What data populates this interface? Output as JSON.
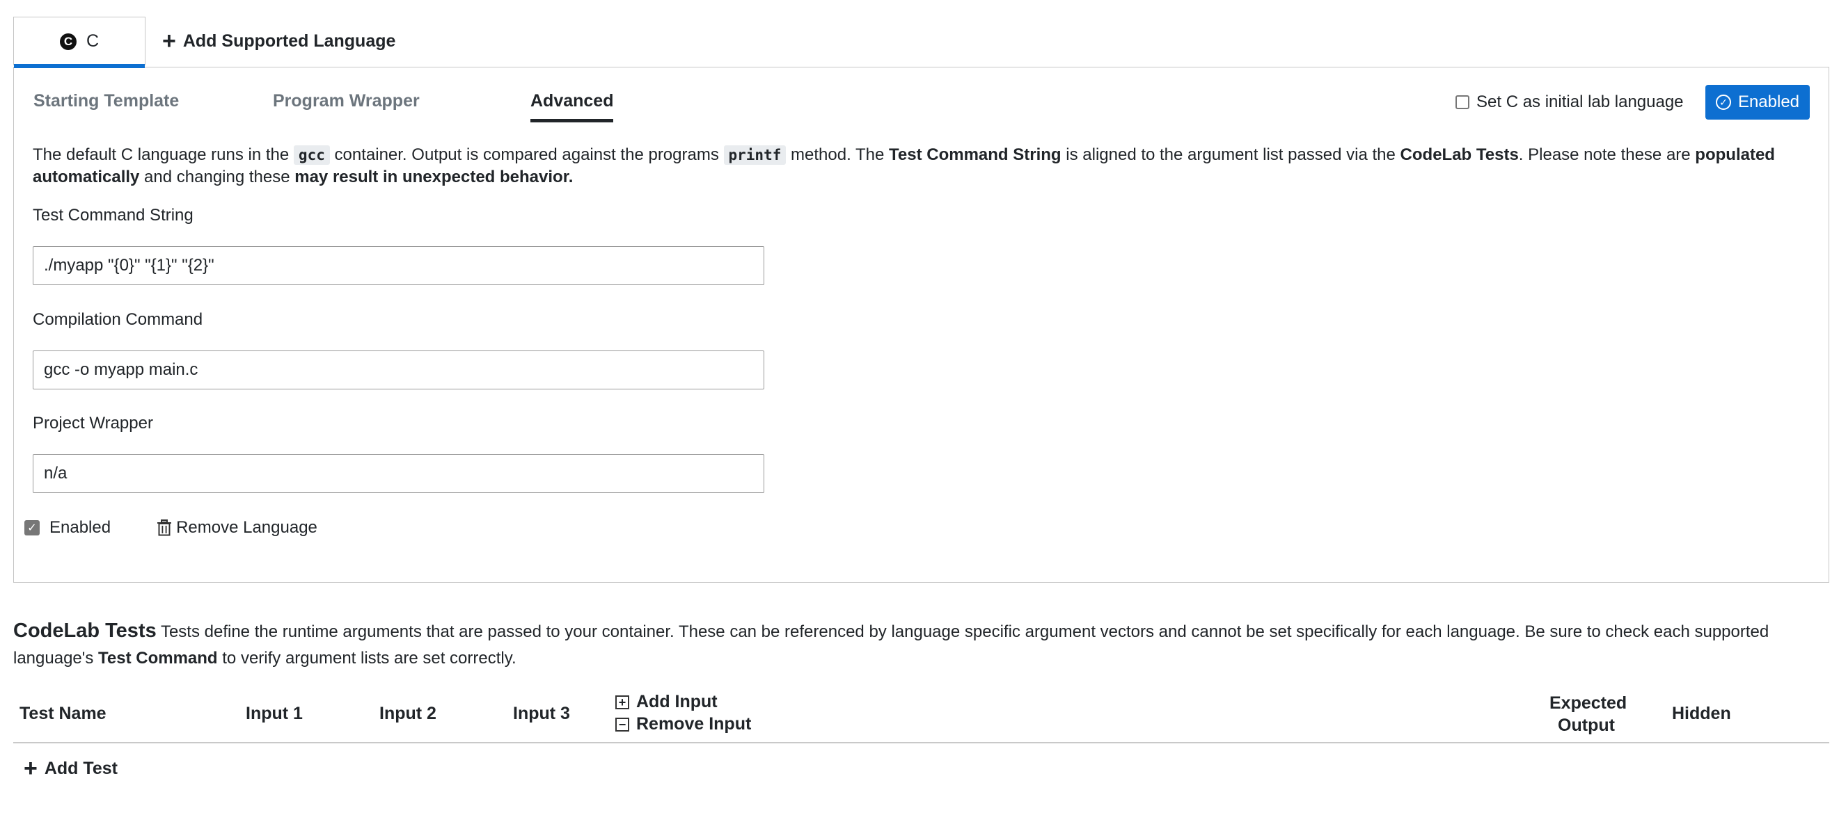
{
  "language_tabs": {
    "active": {
      "icon": "c-language-icon",
      "label": "C"
    },
    "add_label": "Add Supported Language"
  },
  "sub_tabs": [
    {
      "label": "Starting Template",
      "active": false
    },
    {
      "label": "Program Wrapper",
      "active": false
    },
    {
      "label": "Advanced",
      "active": true
    }
  ],
  "initial_language_label": "Set C as initial lab language",
  "enabled_button_label": "Enabled",
  "description": {
    "p1": "The default C language runs in the ",
    "code1": "gcc",
    "p2": " container. Output is compared against the programs ",
    "code2": "printf",
    "p3": " method. The ",
    "b1": "Test Command String",
    "p4": " is aligned to the argument list passed via the ",
    "b2": "CodeLab Tests",
    "p5": ". Please note these are ",
    "b3": "populated automatically",
    "p6": " and changing these ",
    "b4": "may result in unexpected behavior."
  },
  "fields": {
    "test_command": {
      "label": "Test Command String",
      "value": "./myapp \"{0}\" \"{1}\" \"{2}\""
    },
    "compilation": {
      "label": "Compilation Command",
      "value": "gcc -o myapp main.c"
    },
    "wrapper": {
      "label": "Project Wrapper",
      "value": "n/a"
    }
  },
  "enabled_checkbox_label": "Enabled",
  "remove_language_label": "Remove Language",
  "codelab": {
    "title": "CodeLab Tests",
    "d1": " Tests define the runtime arguments that are passed to your container. These can be referenced by language specific argument vectors and cannot be set specifically for each language. Be sure to check each supported language's ",
    "d_bold": "Test Command",
    "d2": " to verify argument lists are set correctly."
  },
  "table": {
    "headers": {
      "name": "Test Name",
      "input1": "Input 1",
      "input2": "Input 2",
      "input3": "Input 3",
      "expected_1": "Expected",
      "expected_2": "Output",
      "hidden": "Hidden"
    },
    "add_input": "Add Input",
    "remove_input": "Remove Input",
    "add_test": "Add Test"
  },
  "colors": {
    "accent": "#0d6fd1",
    "border": "#c6c6c6",
    "text": "#212529",
    "muted": "#6c757d"
  }
}
